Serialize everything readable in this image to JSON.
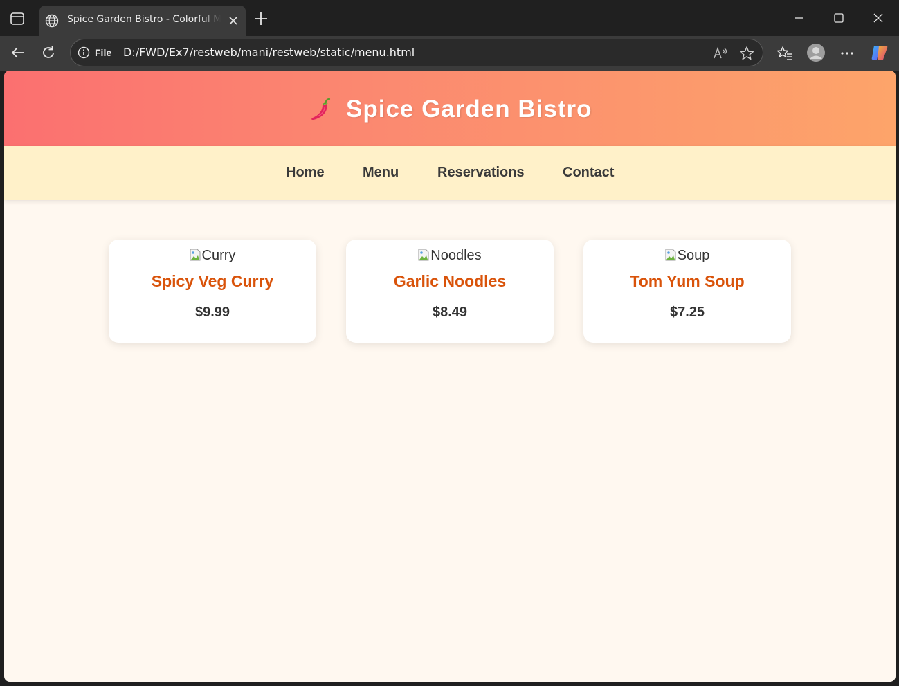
{
  "browser": {
    "tab": {
      "title": "Spice Garden Bistro - Colorful Menu"
    },
    "address": {
      "scheme_label": "File",
      "url": "D:/FWD/Ex7/restweb/mani/restweb/static/menu.html"
    }
  },
  "site": {
    "logo_icon": "chili-pepper-icon",
    "title": "Spice Garden Bistro",
    "nav": [
      "Home",
      "Menu",
      "Reservations",
      "Contact"
    ]
  },
  "menu": {
    "items": [
      {
        "image_alt": "Curry",
        "name": "Spicy Veg Curry",
        "price": "$9.99"
      },
      {
        "image_alt": "Noodles",
        "name": "Garlic Noodles",
        "price": "$8.49"
      },
      {
        "image_alt": "Soup",
        "name": "Tom Yum Soup",
        "price": "$7.25"
      }
    ]
  },
  "colors": {
    "header_gradient_start": "#fb7070",
    "header_gradient_end": "#fda46a",
    "nav_background": "#fff1c9",
    "dish_name": "#d9530a",
    "page_background": "#fff8f0"
  }
}
